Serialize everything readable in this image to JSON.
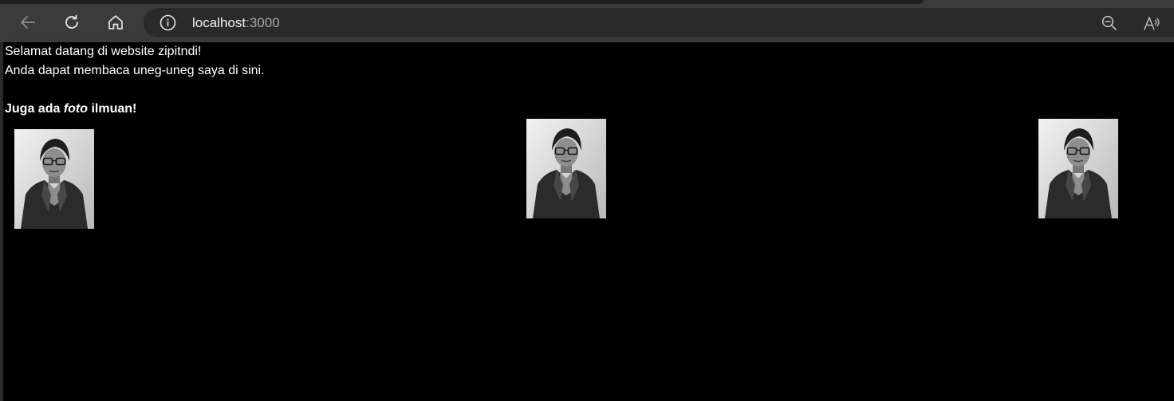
{
  "browser": {
    "url_host": "localhost",
    "url_port": ":3000",
    "icons": {
      "back": "back-arrow-icon",
      "refresh": "refresh-icon",
      "home": "home-icon",
      "info": "info-icon",
      "zoom": "zoom-out-icon",
      "read_aloud": "read-aloud-icon"
    }
  },
  "page": {
    "welcome": "Selamat datang di website zipitndi!",
    "intro": "Anda dapat membaca uneg-uneg saya di sini.",
    "heading": {
      "before": "Juga ada ",
      "emphasis": "foto",
      "after": " ilmuan!"
    },
    "photos_count": 3
  },
  "colors": {
    "toolbar": "#3b3b3b",
    "address_bar": "#2a2a2a",
    "page_background": "#000000",
    "page_text": "#ffffff"
  }
}
